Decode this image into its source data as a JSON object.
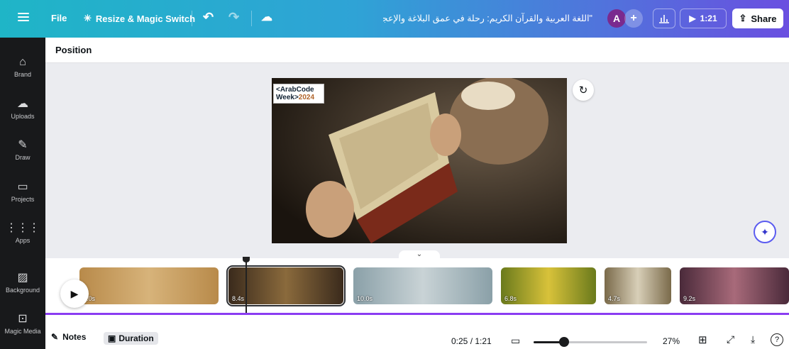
{
  "topbar": {
    "file_label": "File",
    "resize_label": "Resize & Magic Switch",
    "doc_title": "\"اللغة العربية والقرآن الكريم: رحلة في عمق البلاغة والإعجاز",
    "avatar_initial": "A",
    "play_time": "1:21",
    "share_label": "Share"
  },
  "sidebar": {
    "items": [
      {
        "label": "Brand",
        "icon": "brand-icon"
      },
      {
        "label": "Uploads",
        "icon": "upload-icon"
      },
      {
        "label": "Draw",
        "icon": "draw-icon"
      },
      {
        "label": "Projects",
        "icon": "folder-icon"
      },
      {
        "label": "Apps",
        "icon": "apps-icon"
      },
      {
        "label": "Background",
        "icon": "background-icon"
      },
      {
        "label": "Magic Media",
        "icon": "magic-media-icon"
      }
    ]
  },
  "context": {
    "position_label": "Position"
  },
  "canvas": {
    "badge_line1": "<ArabCode",
    "badge_line2": "Week>",
    "badge_year": "2024"
  },
  "timeline": {
    "clips": [
      {
        "duration": "0.0s",
        "colors": [
          "#b88a4a",
          "#d7b37a"
        ]
      },
      {
        "duration": "8.4s",
        "colors": [
          "#3a2a1c",
          "#8a6a3c"
        ]
      },
      {
        "duration": "10.0s",
        "colors": [
          "#8aa0a8",
          "#c9d3d6"
        ]
      },
      {
        "duration": "6.8s",
        "colors": [
          "#6a7a1c",
          "#d8c23a"
        ]
      },
      {
        "duration": "4.7s",
        "colors": [
          "#7a6a4a",
          "#d8cfb8"
        ]
      },
      {
        "duration": "9.2s",
        "colors": [
          "#4a2a3a",
          "#a86a7a"
        ]
      }
    ]
  },
  "footer": {
    "notes_label": "Notes",
    "duration_label": "Duration",
    "time": "0:25 / 1:21",
    "zoom": "27%",
    "zoom_fraction": 0.27
  },
  "colors": {
    "accent": "#8b3df2",
    "sidebar_bg": "#18191b"
  }
}
